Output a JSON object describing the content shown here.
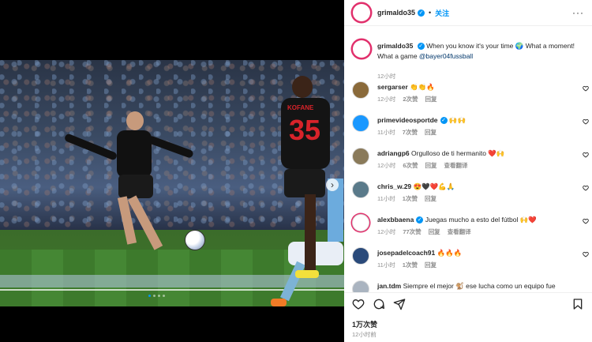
{
  "header": {
    "username": "grimaldo35",
    "verified": "✓",
    "follow_label": "关注",
    "separator": "•",
    "more": "···"
  },
  "caption": {
    "username": "grimaldo35",
    "text_1": "When you know it's your time 🌍 What a moment! What a game ",
    "mention": "@bayer04fussball",
    "time": "12小时"
  },
  "comments": [
    {
      "username": "sergarser",
      "verified": false,
      "text": "👏👏🔥",
      "time": "12小时",
      "likes": "2次赞",
      "reply": "回复",
      "translate": "",
      "avatar_color": "#8a6a3a"
    },
    {
      "username": "primevideosportde",
      "verified": true,
      "text": "🙌🙌",
      "time": "11小时",
      "likes": "7次赞",
      "reply": "回复",
      "translate": "",
      "avatar_color": "#1a98ff"
    },
    {
      "username": "adriangp6",
      "verified": false,
      "text": "Orgulloso de ti hermanito ❤️🙌",
      "time": "12小时",
      "likes": "6次赞",
      "reply": "回复",
      "translate": "查看翻译",
      "avatar_color": "#8a7a5a"
    },
    {
      "username": "chris_w.29",
      "verified": false,
      "text": "😍🖤❤️💪🙏",
      "time": "11小时",
      "likes": "1次赞",
      "reply": "回复",
      "translate": "",
      "avatar_color": "#5a7a8a"
    },
    {
      "username": "alexbbaena",
      "verified": true,
      "text": "Juegas mucho a esto del fútbol 🙌❤️",
      "time": "12小时",
      "likes": "77次赞",
      "reply": "回复",
      "translate": "查看翻译",
      "avatar_color": "#ffffff"
    },
    {
      "username": "josepadelcoach91",
      "verified": false,
      "text": "🔥🔥🔥",
      "time": "11小时",
      "likes": "1次赞",
      "reply": "回复",
      "translate": "",
      "avatar_color": "#2a4a7a"
    },
    {
      "username": "jan.tdm",
      "verified": false,
      "text": "Siempre el mejor 🐒 ese lucha como un equipo fue",
      "time": "",
      "likes": "",
      "reply": "",
      "translate": "",
      "avatar_color": "#aab4c0"
    }
  ],
  "actions": {
    "like_icon": "heart-icon",
    "comment_icon": "comment-icon",
    "share_icon": "share-icon",
    "save_icon": "bookmark-icon",
    "likes_count": "1万次赞",
    "post_time": "12小时前"
  },
  "media": {
    "player_number": "35",
    "player_name": "KOFANE",
    "next_arrow": "›"
  },
  "colors": {
    "accent": "#0095f6",
    "ring": "#e1306c",
    "muted": "#8e8e8e"
  }
}
